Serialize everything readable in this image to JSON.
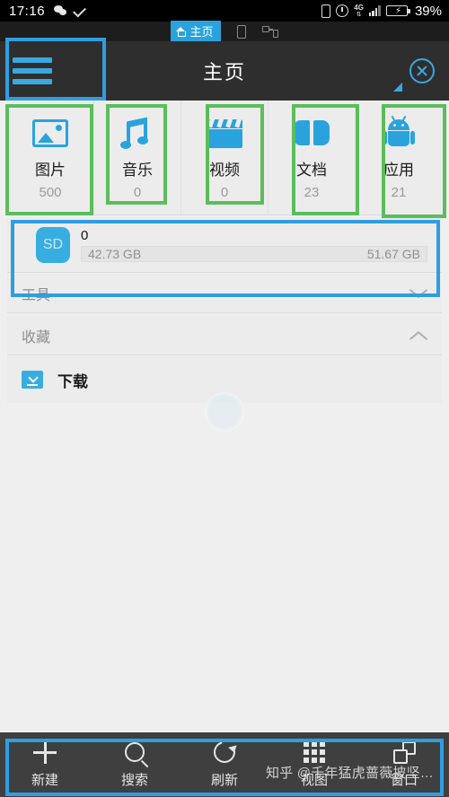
{
  "status_bar": {
    "time": "17:16",
    "icons_left": [
      "wechat-icon",
      "check-icon"
    ],
    "icons_right": [
      "vibrate-icon",
      "alarm-clock-icon",
      "4g-icon",
      "signal-icon",
      "battery-charging-icon"
    ],
    "network_label": "4G",
    "network_sub": "4G",
    "battery_percent": "39%"
  },
  "tab_strip": {
    "home_tab": "主页",
    "phone_tab_icon": "phone-icon",
    "devices_tab_icon": "devices-icon"
  },
  "app_bar": {
    "menu_icon": "hamburger-menu-icon",
    "title": "主页",
    "close_icon": "close-circle-icon",
    "resize_handle_icon": "resize-triangle-icon"
  },
  "categories": [
    {
      "label": "图片",
      "count": "500",
      "icon": "picture-icon"
    },
    {
      "label": "音乐",
      "count": "0",
      "icon": "music-note-icon"
    },
    {
      "label": "视频",
      "count": "0",
      "icon": "video-clapper-icon"
    },
    {
      "label": "文档",
      "count": "23",
      "icon": "book-icon"
    },
    {
      "label": "应用",
      "count": "21",
      "icon": "android-robot-icon"
    }
  ],
  "storage": {
    "icon_label": "SD",
    "title": "0",
    "used": "42.73 GB",
    "total": "51.67 GB"
  },
  "sections": [
    {
      "label": "工具",
      "chevron": "chevron-down-icon"
    },
    {
      "label": "收藏",
      "chevron": "chevron-up-icon"
    }
  ],
  "favorites": [
    {
      "label": "下载",
      "icon": "download-folder-icon"
    }
  ],
  "toolbar": [
    {
      "label": "新建",
      "icon": "plus-icon"
    },
    {
      "label": "搜索",
      "icon": "search-icon"
    },
    {
      "label": "刷新",
      "icon": "refresh-icon"
    },
    {
      "label": "视图",
      "icon": "grid-view-icon"
    },
    {
      "label": "窗口",
      "icon": "windows-icon"
    }
  ],
  "watermark": "知乎 @千年猛虎蔷薇披坚…",
  "colors": {
    "accent_blue": "#2aa3dd",
    "annotation_blue": "#2f9ee0",
    "annotation_green": "#5cbd5c",
    "panel_bg": "#ececec",
    "toolbar_bg": "#3f3f3f",
    "appbar_bg": "#2e2e2e"
  }
}
